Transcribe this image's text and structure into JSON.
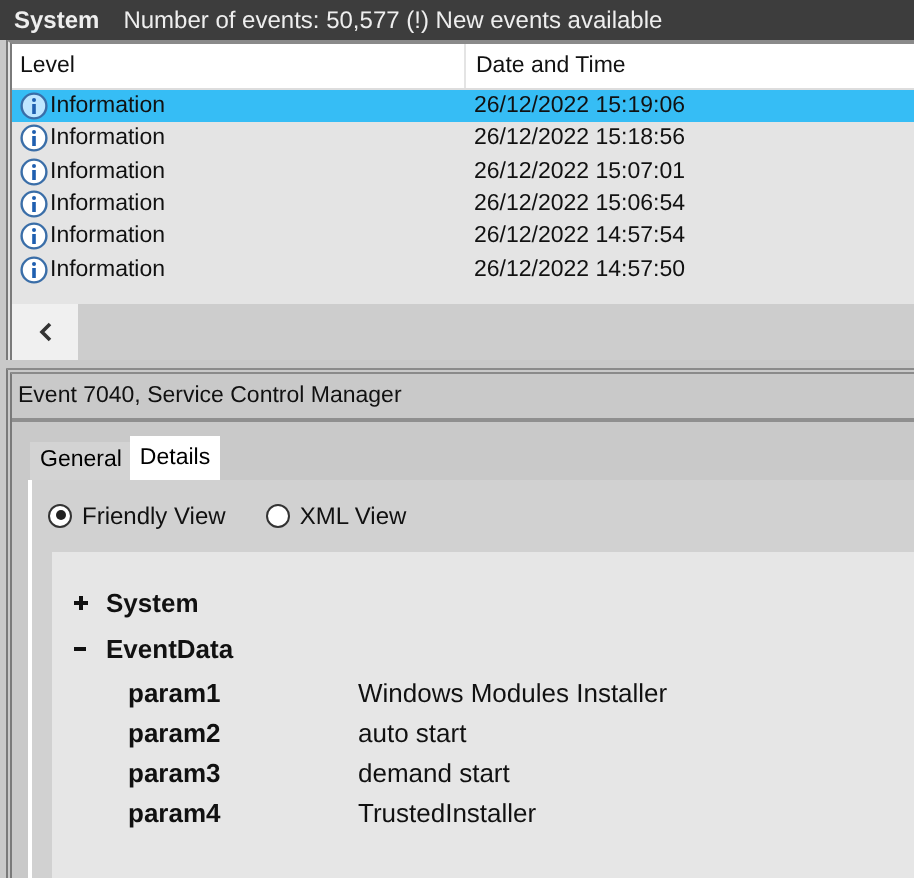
{
  "header": {
    "title": "System",
    "status": "Number of events: 50,577 (!) New events available"
  },
  "table": {
    "columns": [
      "Level",
      "Date and Time"
    ],
    "rows": [
      {
        "level": "Information",
        "datetime": "26/12/2022 15:19:06",
        "selected": true
      },
      {
        "level": "Information",
        "datetime": "26/12/2022 15:18:56",
        "selected": false
      },
      {
        "level": "Information",
        "datetime": "26/12/2022 15:07:01",
        "selected": false
      },
      {
        "level": "Information",
        "datetime": "26/12/2022 15:06:54",
        "selected": false
      },
      {
        "level": "Information",
        "datetime": "26/12/2022 14:57:54",
        "selected": false
      },
      {
        "level": "Information",
        "datetime": "26/12/2022 14:57:50",
        "selected": false
      }
    ]
  },
  "event": {
    "title": "Event 7040, Service Control Manager"
  },
  "tabs": [
    {
      "label": "General",
      "selected": false
    },
    {
      "label": "Details",
      "selected": true
    }
  ],
  "views": [
    {
      "label": "Friendly View",
      "selected": true
    },
    {
      "label": "XML View",
      "selected": false
    }
  ],
  "tree": [
    {
      "label": "System",
      "expanded": false
    },
    {
      "label": "EventData",
      "expanded": true,
      "children": [
        {
          "name": "param1",
          "value": "Windows Modules Installer"
        },
        {
          "name": "param2",
          "value": "auto start"
        },
        {
          "name": "param3",
          "value": "demand start"
        },
        {
          "name": "param4",
          "value": "TrustedInstaller"
        }
      ]
    }
  ]
}
